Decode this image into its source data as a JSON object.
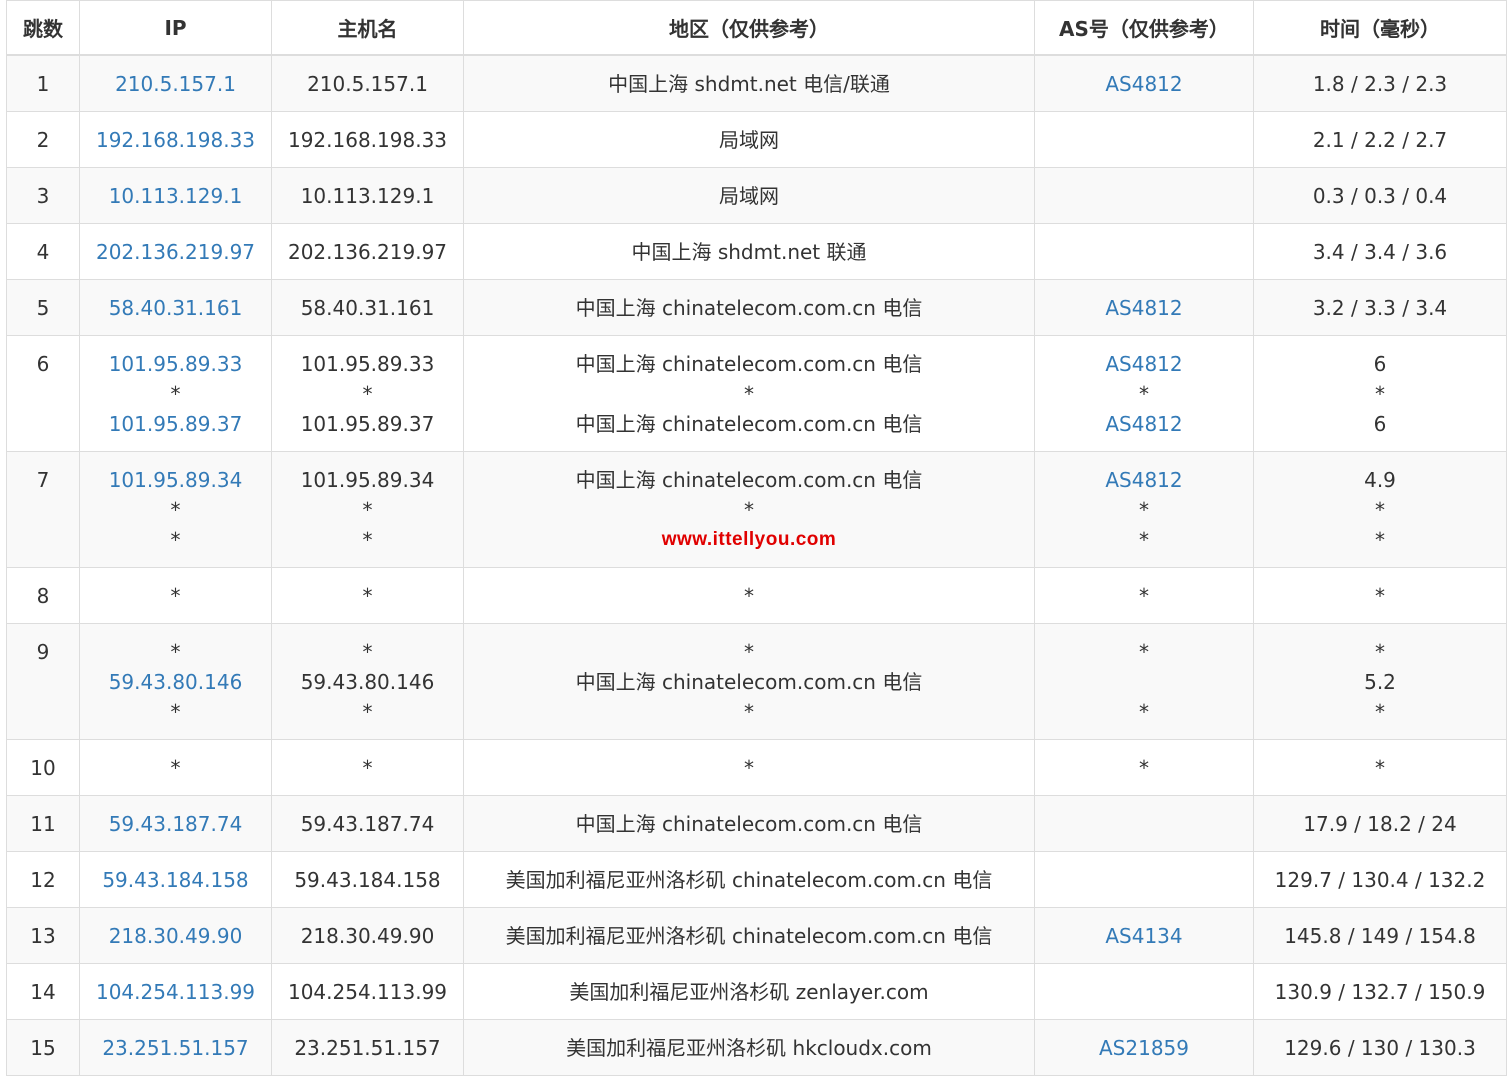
{
  "headers": {
    "hop": "跳数",
    "ip": "IP",
    "host": "主机名",
    "region": "地区（仅供参考）",
    "as": "AS号（仅供参考）",
    "time": "时间（毫秒）"
  },
  "watermark": "www.ittellyou.com",
  "rows": [
    {
      "hop": "1",
      "lines": [
        {
          "ip": "210.5.157.1",
          "host": "210.5.157.1",
          "region": "中国上海 shdmt.net 电信/联通",
          "as": "AS4812",
          "time": "1.8 / 2.3 / 2.3"
        }
      ]
    },
    {
      "hop": "2",
      "lines": [
        {
          "ip": "192.168.198.33",
          "host": "192.168.198.33",
          "region": "局域网",
          "as": "",
          "time": "2.1 / 2.2 / 2.7"
        }
      ]
    },
    {
      "hop": "3",
      "lines": [
        {
          "ip": "10.113.129.1",
          "host": "10.113.129.1",
          "region": "局域网",
          "as": "",
          "time": "0.3 / 0.3 / 0.4"
        }
      ]
    },
    {
      "hop": "4",
      "lines": [
        {
          "ip": "202.136.219.97",
          "host": "202.136.219.97",
          "region": "中国上海 shdmt.net 联通",
          "as": "",
          "time": "3.4 / 3.4 / 3.6"
        }
      ]
    },
    {
      "hop": "5",
      "lines": [
        {
          "ip": "58.40.31.161",
          "host": "58.40.31.161",
          "region": "中国上海 chinatelecom.com.cn 电信",
          "as": "AS4812",
          "time": "3.2 / 3.3 / 3.4"
        }
      ]
    },
    {
      "hop": "6",
      "lines": [
        {
          "ip": "101.95.89.33",
          "host": "101.95.89.33",
          "region": "中国上海 chinatelecom.com.cn 电信",
          "as": "AS4812",
          "time": "6"
        },
        {
          "ip": "*",
          "host": "*",
          "region": "*",
          "as": "*",
          "time": "*"
        },
        {
          "ip": "101.95.89.37",
          "host": "101.95.89.37",
          "region": "中国上海 chinatelecom.com.cn 电信",
          "as": "AS4812",
          "time": "6"
        }
      ]
    },
    {
      "hop": "7",
      "lines": [
        {
          "ip": "101.95.89.34",
          "host": "101.95.89.34",
          "region": "中国上海 chinatelecom.com.cn 电信",
          "as": "AS4812",
          "time": "4.9"
        },
        {
          "ip": "*",
          "host": "*",
          "region": "*",
          "as": "*",
          "time": "*"
        },
        {
          "ip": "*",
          "host": "*",
          "region": "",
          "as": "*",
          "time": "*"
        }
      ]
    },
    {
      "hop": "8",
      "lines": [
        {
          "ip": "*",
          "host": "*",
          "region": "*",
          "as": "*",
          "time": "*"
        }
      ]
    },
    {
      "hop": "9",
      "lines": [
        {
          "ip": "*",
          "host": "*",
          "region": "*",
          "as": "*",
          "time": "*"
        },
        {
          "ip": "59.43.80.146",
          "host": "59.43.80.146",
          "region": "中国上海 chinatelecom.com.cn 电信",
          "as": "",
          "time": "5.2"
        },
        {
          "ip": "*",
          "host": "*",
          "region": "*",
          "as": "*",
          "time": "*"
        }
      ]
    },
    {
      "hop": "10",
      "lines": [
        {
          "ip": "*",
          "host": "*",
          "region": "*",
          "as": "*",
          "time": "*"
        }
      ]
    },
    {
      "hop": "11",
      "lines": [
        {
          "ip": "59.43.187.74",
          "host": "59.43.187.74",
          "region": "中国上海 chinatelecom.com.cn 电信",
          "as": "",
          "time": "17.9 / 18.2 / 24"
        }
      ]
    },
    {
      "hop": "12",
      "lines": [
        {
          "ip": "59.43.184.158",
          "host": "59.43.184.158",
          "region": "美国加利福尼亚州洛杉矶 chinatelecom.com.cn 电信",
          "as": "",
          "time": "129.7 / 130.4 / 132.2"
        }
      ]
    },
    {
      "hop": "13",
      "lines": [
        {
          "ip": "218.30.49.90",
          "host": "218.30.49.90",
          "region": "美国加利福尼亚州洛杉矶 chinatelecom.com.cn 电信",
          "as": "AS4134",
          "time": "145.8 / 149 / 154.8"
        }
      ]
    },
    {
      "hop": "14",
      "lines": [
        {
          "ip": "104.254.113.99",
          "host": "104.254.113.99",
          "region": "美国加利福尼亚州洛杉矶 zenlayer.com",
          "as": "",
          "time": "130.9 / 132.7 / 150.9"
        }
      ]
    },
    {
      "hop": "15",
      "lines": [
        {
          "ip": "23.251.51.157",
          "host": "23.251.51.157",
          "region": "美国加利福尼亚州洛杉矶 hkcloudx.com",
          "as": "AS21859",
          "time": "129.6 / 130 / 130.3"
        }
      ]
    }
  ],
  "colors": {
    "link": "#337ab7",
    "stripe": "#f9f9f9",
    "border": "#dddddd",
    "watermark": "#e00000"
  }
}
